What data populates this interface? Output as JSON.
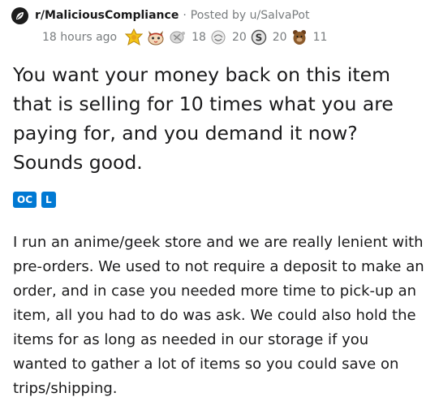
{
  "post": {
    "subreddit": "r/MaliciousCompliance",
    "separator": "·",
    "posted_by": "Posted by u/SalvaPot",
    "time": "18 hours ago",
    "awards": [
      {
        "icon": "gold-star-award-icon",
        "count": ""
      },
      {
        "icon": "cat-face-award-icon",
        "count": ""
      },
      {
        "icon": "silver-award-icon",
        "count": "18"
      },
      {
        "icon": "wholesome-award-icon",
        "count": "20"
      },
      {
        "icon": "coin-award-icon",
        "count": "20"
      },
      {
        "icon": "bear-award-icon",
        "count": "11"
      }
    ],
    "title": "You want your money back on this item that is selling for 10 times what you are paying for, and you demand it now? Sounds good.",
    "flairs": [
      {
        "label": "OC",
        "color": "#0079d3"
      },
      {
        "label": "L",
        "color": "#0079d3"
      }
    ],
    "body": "I run an anime/geek store and we are really lenient with pre-orders. We used to not require a deposit to make an order, and in case you needed more time to pick-up an item, all you had to do was ask. We could also hold the items for as long as needed in our storage if you wanted to gather a lot of items so you could save on trips/shipping."
  }
}
